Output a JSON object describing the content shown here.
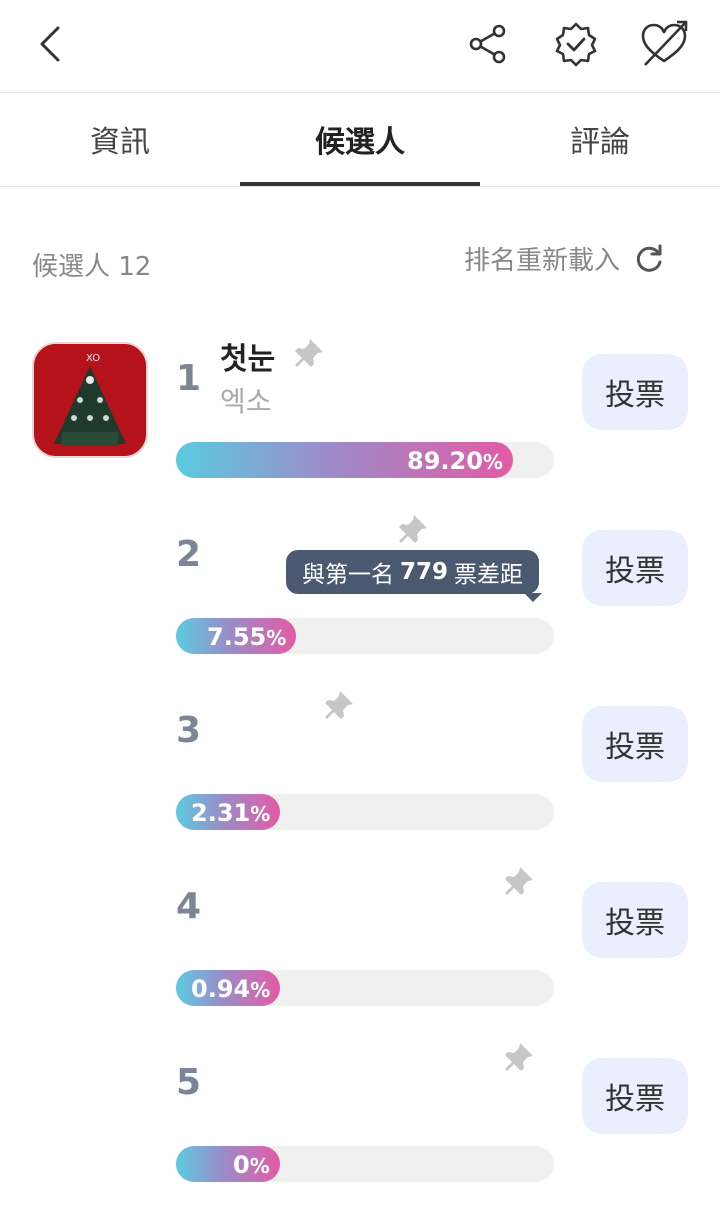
{
  "tabs": [
    "資訊",
    "候選人",
    "評論"
  ],
  "candidates_label": "候選人 12",
  "reload_label": "排名重新載入",
  "vote_label": "投票",
  "tooltip": {
    "prefix": "與第一名",
    "gap": "779",
    "suffix": "票差距"
  },
  "rows": [
    {
      "rank": "1",
      "title": "첫눈",
      "artist": "엑소",
      "percent_num": "89.20",
      "percent_value": 89.2
    },
    {
      "rank": "2",
      "title": "",
      "artist": "",
      "percent_num": "7.55",
      "percent_value": 7.55
    },
    {
      "rank": "3",
      "title": "",
      "artist": "",
      "percent_num": "2.31",
      "percent_value": 2.31
    },
    {
      "rank": "4",
      "title": "",
      "artist": "",
      "percent_num": "0.94",
      "percent_value": 0.94
    },
    {
      "rank": "5",
      "title": "",
      "artist": "",
      "percent_num": "0",
      "percent_value": 0
    }
  ],
  "percent_sign": "%",
  "colors": {
    "bar_start": "#5ccbe0",
    "bar_end": "#e35ba4",
    "vote_bg": "#e9effc",
    "tooltip_bg": "#4a5870"
  },
  "icons": {
    "back": "chevron-left-icon",
    "share": "share-icon",
    "badge": "verified-badge-icon",
    "heart": "heart-arrow-icon",
    "reload": "refresh-icon",
    "pin": "pin-icon"
  }
}
